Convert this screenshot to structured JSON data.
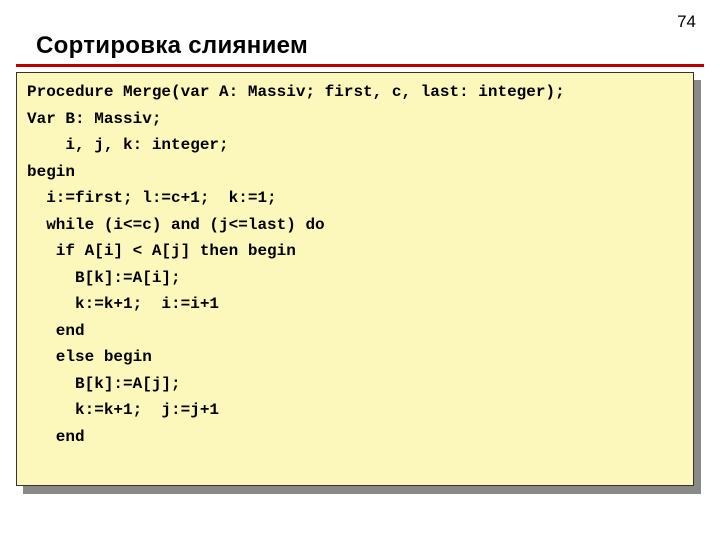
{
  "page_number": "74",
  "title": "Сортировка слиянием",
  "code": {
    "line1": "Procedure Merge(var A: Massiv; first, c, last: integer);",
    "line2": "Var B: Massiv;",
    "line3": "    i, j, k: integer;",
    "line4": "begin",
    "line5": "  i:=first; l:=c+1;  k:=1;",
    "line6": "  while (i<=c) and (j<=last) do",
    "line7": "   if A[i] < A[j] then begin",
    "line8": "     B[k]:=A[i];",
    "line9": "     k:=k+1;  i:=i+1",
    "line10": "   end",
    "line11": "   else begin",
    "line12": "     B[k]:=A[j];",
    "line13": "     k:=k+1;  j:=j+1",
    "line14": "   end"
  }
}
